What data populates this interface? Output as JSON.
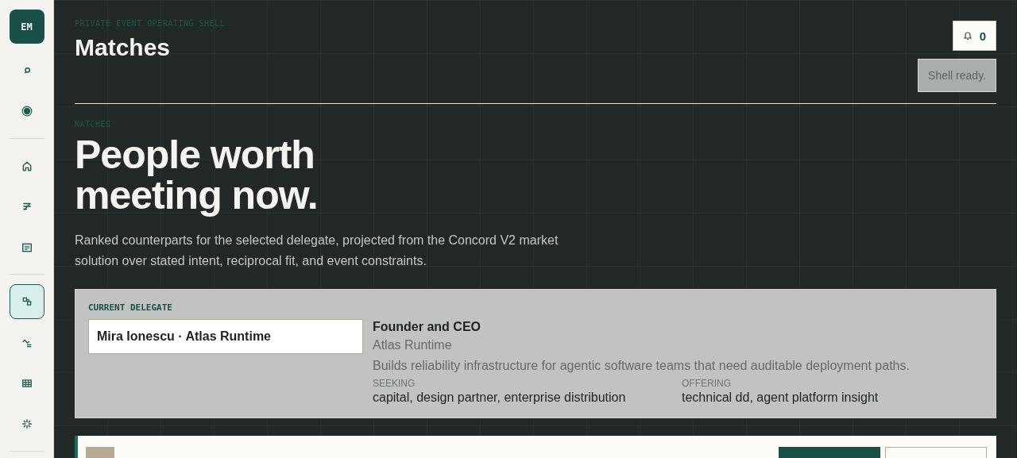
{
  "sidebar": {
    "avatar": "EM",
    "groups": [
      [
        {
          "kind": "search",
          "selected": false
        },
        {
          "kind": "target",
          "selected": false
        }
      ],
      [
        {
          "kind": "home",
          "selected": false
        },
        {
          "kind": "filter",
          "selected": false
        },
        {
          "kind": "list",
          "selected": false
        }
      ],
      [
        {
          "kind": "matches",
          "selected": true
        },
        {
          "kind": "trend",
          "selected": false
        },
        {
          "kind": "table",
          "selected": false
        },
        {
          "kind": "sparkle",
          "selected": false
        }
      ]
    ]
  },
  "header": {
    "eyebrow": "PRIVATE EVENT OPERATING SHELL",
    "title": "Matches",
    "notifications": {
      "count": "0"
    },
    "toast": "Shell ready."
  },
  "hero": {
    "eyebrow": "MATCHES",
    "headline": "People worth meeting now.",
    "intro": "Ranked counterparts for the selected delegate, projected from the Concord V2 market solution over stated intent, reciprocal fit, and event constraints."
  },
  "delegate": {
    "label": "CURRENT DELEGATE",
    "value": "Mira Ionescu · Atlas Runtime",
    "role": "Founder and CEO",
    "company": "Atlas Runtime",
    "bio": "Builds reliability infrastructure for agentic software teams that need auditable deployment paths.",
    "facts": [
      {
        "label": "SEEKING",
        "value": "capital, design partner, enterprise distribution"
      },
      {
        "label": "OFFERING",
        "value": "technical dd, agent platform insight"
      }
    ]
  }
}
